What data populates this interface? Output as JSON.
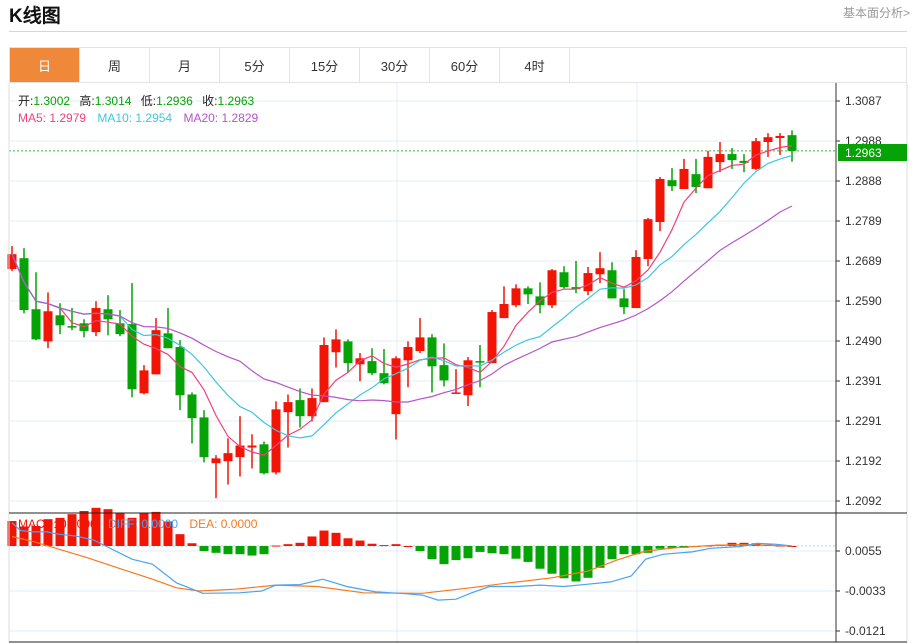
{
  "header": {
    "title": "K线图",
    "fundamental_link": "基本面分析>"
  },
  "tabs": [
    {
      "label": "日",
      "active": true
    },
    {
      "label": "周"
    },
    {
      "label": "月"
    },
    {
      "label": "5分"
    },
    {
      "label": "15分"
    },
    {
      "label": "30分"
    },
    {
      "label": "60分"
    },
    {
      "label": "4时"
    }
  ],
  "colors": {
    "up": "#f21405",
    "down": "#05a305",
    "ma5": "#f2407a",
    "ma10": "#3cc8dc",
    "ma20": "#b455c8",
    "diff": "#4aa3f0",
    "dea": "#f57a1e",
    "tab_active": "#f0883a"
  },
  "info": {
    "open_label": "开:",
    "open": "1.3002",
    "high_label": "高:",
    "high": "1.3014",
    "low_label": "低:",
    "low": "1.2936",
    "close_label": "收:",
    "close": "1.2963",
    "ma5": "MA5: 1.2979",
    "ma10": "MA10: 1.2954",
    "ma20": "MA20: 1.2829"
  },
  "macd_info": {
    "macd": "MACD: 0.0000",
    "diff": "DIFF: 0.0000",
    "dea": "DEA: 0.0000"
  },
  "current_price": "1.2963",
  "chart_data": [
    {
      "type": "candlestick",
      "title": "K线图 (日)",
      "y_ticks": [
        "1.3087",
        "1.2988",
        "1.2888",
        "1.2789",
        "1.2689",
        "1.2590",
        "1.2490",
        "1.2391",
        "1.2291",
        "1.2192",
        "1.2092"
      ],
      "ylim": [
        1.2092,
        1.3087
      ],
      "ohlc": [
        [
          1.2669,
          1.2726,
          1.2664,
          1.2706
        ],
        [
          1.2696,
          1.2721,
          1.2559,
          1.2567
        ],
        [
          1.2569,
          1.2661,
          1.2492,
          1.2494
        ],
        [
          1.2489,
          1.2611,
          1.2472,
          1.2564
        ],
        [
          1.2554,
          1.2584,
          1.2507,
          1.2529
        ],
        [
          1.2527,
          1.2572,
          1.2517,
          1.2524
        ],
        [
          1.2534,
          1.2544,
          1.2499,
          1.2515
        ],
        [
          1.2512,
          1.2589,
          1.2502,
          1.2572
        ],
        [
          1.2569,
          1.2604,
          1.2504,
          1.2544
        ],
        [
          1.2534,
          1.2567,
          1.2502,
          1.2507
        ],
        [
          1.2532,
          1.2634,
          1.235,
          1.237
        ],
        [
          1.236,
          1.243,
          1.2357,
          1.2417
        ],
        [
          1.2407,
          1.2547,
          1.2407,
          1.2517
        ],
        [
          1.2509,
          1.2572,
          1.2472,
          1.2472
        ],
        [
          1.2475,
          1.2492,
          1.2318,
          1.2355
        ],
        [
          1.2357,
          1.2362,
          1.2235,
          1.2298
        ],
        [
          1.23,
          1.2318,
          1.2188,
          1.2201
        ],
        [
          1.2186,
          1.2206,
          1.2099,
          1.2198
        ],
        [
          1.2191,
          1.2248,
          1.2133,
          1.2211
        ],
        [
          1.2201,
          1.2303,
          1.2153,
          1.223
        ],
        [
          1.2225,
          1.2258,
          1.2173,
          1.223
        ],
        [
          1.2233,
          1.224,
          1.2158,
          1.2161
        ],
        [
          1.2163,
          1.234,
          1.2158,
          1.232
        ],
        [
          1.2313,
          1.2357,
          1.2225,
          1.2338
        ],
        [
          1.2343,
          1.2372,
          1.2275,
          1.2303
        ],
        [
          1.2303,
          1.2372,
          1.229,
          1.2348
        ],
        [
          1.2338,
          1.2499,
          1.2338,
          1.248
        ],
        [
          1.2462,
          1.2519,
          1.2424,
          1.2494
        ],
        [
          1.2489,
          1.2494,
          1.2412,
          1.2435
        ],
        [
          1.2432,
          1.246,
          1.239,
          1.2447
        ],
        [
          1.244,
          1.2472,
          1.2405,
          1.241
        ],
        [
          1.241,
          1.247,
          1.2382,
          1.2385
        ],
        [
          1.2308,
          1.2452,
          1.2245,
          1.2447
        ],
        [
          1.2442,
          1.2489,
          1.2375,
          1.2475
        ],
        [
          1.2465,
          1.2547,
          1.246,
          1.2499
        ],
        [
          1.2499,
          1.2507,
          1.2362,
          1.2427
        ],
        [
          1.243,
          1.2484,
          1.2377,
          1.2392
        ],
        [
          1.236,
          1.242,
          1.236,
          1.2362
        ],
        [
          1.2355,
          1.245,
          1.2328,
          1.2442
        ],
        [
          1.244,
          1.248,
          1.2375,
          1.2437
        ],
        [
          1.2435,
          1.2567,
          1.2435,
          1.2562
        ],
        [
          1.2547,
          1.2626,
          1.2547,
          1.2582
        ],
        [
          1.2579,
          1.2631,
          1.2574,
          1.2621
        ],
        [
          1.2621,
          1.2626,
          1.2582,
          1.2606
        ],
        [
          1.2601,
          1.2636,
          1.2559,
          1.2579
        ],
        [
          1.2579,
          1.2669,
          1.2572,
          1.2666
        ],
        [
          1.2661,
          1.2676,
          1.2621,
          1.2624
        ],
        [
          1.2624,
          1.2689,
          1.2609,
          1.2619
        ],
        [
          1.2614,
          1.2674,
          1.2604,
          1.2659
        ],
        [
          1.2656,
          1.2711,
          1.2634,
          1.2671
        ],
        [
          1.2666,
          1.2686,
          1.2596,
          1.2596
        ],
        [
          1.2596,
          1.2619,
          1.2557,
          1.2574
        ],
        [
          1.2572,
          1.2716,
          1.2572,
          1.2699
        ],
        [
          1.2694,
          1.2796,
          1.2676,
          1.2793
        ],
        [
          1.2786,
          1.2898,
          1.2763,
          1.2893
        ],
        [
          1.289,
          1.292,
          1.2863,
          1.2875
        ],
        [
          1.2868,
          1.2943,
          1.2868,
          1.2918
        ],
        [
          1.2905,
          1.2943,
          1.2858,
          1.2873
        ],
        [
          1.287,
          1.2963,
          1.287,
          1.2948
        ],
        [
          1.2935,
          1.2985,
          1.291,
          1.2955
        ],
        [
          1.2955,
          1.297,
          1.2918,
          1.294
        ],
        [
          1.2938,
          1.2955,
          1.291,
          1.2933
        ],
        [
          1.2918,
          1.2995,
          1.2915,
          1.2987
        ],
        [
          1.2985,
          1.3007,
          1.2948,
          1.2997
        ],
        [
          1.2995,
          1.3007,
          1.2953,
          1.3
        ],
        [
          1.3002,
          1.3014,
          1.2936,
          1.2963
        ]
      ],
      "ma_periods": [
        5,
        10,
        20
      ]
    },
    {
      "type": "bar+line",
      "title": "MACD",
      "y_ticks": [
        "0.0055",
        "-0.0033",
        "-0.0121"
      ],
      "ylim": [
        -0.0121,
        0.0055
      ],
      "histogram": [
        0.0055,
        0.0043,
        0.0044,
        0.0059,
        0.0062,
        0.007,
        0.0077,
        0.0084,
        0.0081,
        0.0073,
        0.0062,
        0.0073,
        0.0075,
        0.0054,
        0.0026,
        0.0006,
        -0.0011,
        -0.0015,
        -0.0018,
        -0.0018,
        -0.0021,
        -0.0018,
        0.0001,
        0.0004,
        0.0007,
        0.0021,
        0.0034,
        0.0029,
        0.0017,
        0.0012,
        0.0005,
        0.0002,
        0.0004,
        0.0,
        -0.0011,
        -0.0029,
        -0.004,
        -0.0031,
        -0.0027,
        -0.0013,
        -0.0016,
        -0.0018,
        -0.0028,
        -0.0035,
        -0.005,
        -0.0061,
        -0.0071,
        -0.0078,
        -0.007,
        -0.0048,
        -0.0029,
        -0.0018,
        -0.0018,
        -0.0015,
        -0.0006,
        -0.0004,
        -0.0004,
        -0.0001,
        0.0001,
        0.0003,
        0.0007,
        0.0007,
        0.0006,
        0.0003,
        0.0001,
        0.0
      ],
      "diff": [
        [
          0,
          0.0051
        ],
        [
          0.7,
          0.0034
        ],
        [
          1.7,
          0.0031
        ],
        [
          2.9,
          0.0031
        ],
        [
          3.9,
          0.0026
        ],
        [
          5.3,
          0.0022
        ],
        [
          6.8,
          0.0013
        ],
        [
          7.8,
          0.0
        ],
        [
          10,
          -0.0029
        ],
        [
          11.7,
          -0.004
        ],
        [
          13.7,
          -0.0081
        ],
        [
          15.9,
          -0.0104
        ],
        [
          19,
          -0.0103
        ],
        [
          20.8,
          -0.0099
        ],
        [
          22,
          -0.0086
        ],
        [
          24,
          -0.0085
        ],
        [
          25.9,
          -0.0073
        ],
        [
          27.9,
          -0.0089
        ],
        [
          30.3,
          -0.0101
        ],
        [
          32.8,
          -0.0105
        ],
        [
          34.2,
          -0.0108
        ],
        [
          35.5,
          -0.0119
        ],
        [
          37,
          -0.0117
        ],
        [
          38.2,
          -0.0104
        ],
        [
          39.8,
          -0.0089
        ],
        [
          42,
          -0.0089
        ],
        [
          44,
          -0.0086
        ],
        [
          46,
          -0.0089
        ],
        [
          48,
          -0.0084
        ],
        [
          49.9,
          -0.0079
        ],
        [
          51.6,
          -0.0066
        ],
        [
          52.8,
          -0.0029
        ],
        [
          54.3,
          -0.0018
        ],
        [
          56.7,
          -0.0013
        ],
        [
          58.2,
          -0.0005
        ],
        [
          60.7,
          -0.0001
        ],
        [
          62.1,
          0.0006
        ],
        [
          63.6,
          0.0004
        ],
        [
          65,
          0.0
        ]
      ],
      "dea": [
        [
          0,
          0.0021
        ],
        [
          1.9,
          0.0009
        ],
        [
          3.9,
          -0.0007
        ],
        [
          6.3,
          -0.0026
        ],
        [
          8.8,
          -0.0048
        ],
        [
          11.7,
          -0.0073
        ],
        [
          13.7,
          -0.0092
        ],
        [
          15.6,
          -0.0099
        ],
        [
          18.6,
          -0.0095
        ],
        [
          22,
          -0.0086
        ],
        [
          25.4,
          -0.0089
        ],
        [
          29.3,
          -0.0103
        ],
        [
          34.2,
          -0.0104
        ],
        [
          38.2,
          -0.0092
        ],
        [
          41.1,
          -0.0082
        ],
        [
          45,
          -0.007
        ],
        [
          48,
          -0.0055
        ],
        [
          50.4,
          -0.0031
        ],
        [
          52.8,
          -0.0011
        ],
        [
          55.3,
          -0.0004
        ],
        [
          58.2,
          0.0001
        ],
        [
          60.7,
          0.0003
        ],
        [
          62.6,
          0.0002
        ],
        [
          65,
          0.0
        ]
      ]
    }
  ]
}
